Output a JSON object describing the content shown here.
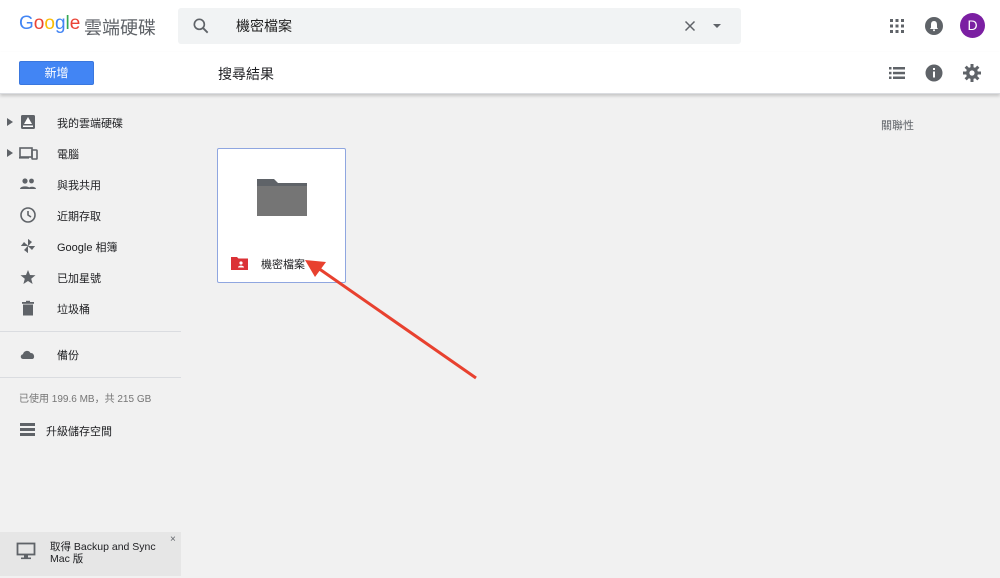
{
  "header": {
    "logo_letters": [
      "G",
      "o",
      "o",
      "g",
      "l",
      "e"
    ],
    "product_name": "雲端硬碟",
    "search": {
      "value": "機密檔案"
    },
    "avatar_letter": "D",
    "colors": {
      "avatar": "#7b1fa2"
    }
  },
  "toolbar": {
    "new_label": "新增",
    "page_title": "搜尋結果"
  },
  "sidebar": {
    "items": [
      {
        "label": "我的雲端硬碟",
        "icon": "drive-icon"
      },
      {
        "label": "電腦",
        "icon": "computers-icon"
      },
      {
        "label": "與我共用",
        "icon": "people-icon"
      },
      {
        "label": "近期存取",
        "icon": "clock-icon"
      },
      {
        "label": "Google 相簿",
        "icon": "photos-pinwheel-icon"
      },
      {
        "label": "已加星號",
        "icon": "star-icon"
      },
      {
        "label": "垃圾桶",
        "icon": "trash-icon"
      }
    ],
    "backup": {
      "label": "備份",
      "icon": "cloud-icon"
    },
    "storage_text": "已使用 199.6 MB，共 215 GB",
    "upgrade_label": "升級儲存空間",
    "banner_text": "取得 Backup and Sync Mac 版",
    "banner_close": "×"
  },
  "main": {
    "sort_label": "關聯性",
    "folder": {
      "name": "機密檔案",
      "icon": "shared-folder-icon"
    },
    "colors": {
      "accent_blue": "#4285f4",
      "folder_red": "#db3236",
      "arrow": "#e8412f"
    }
  }
}
